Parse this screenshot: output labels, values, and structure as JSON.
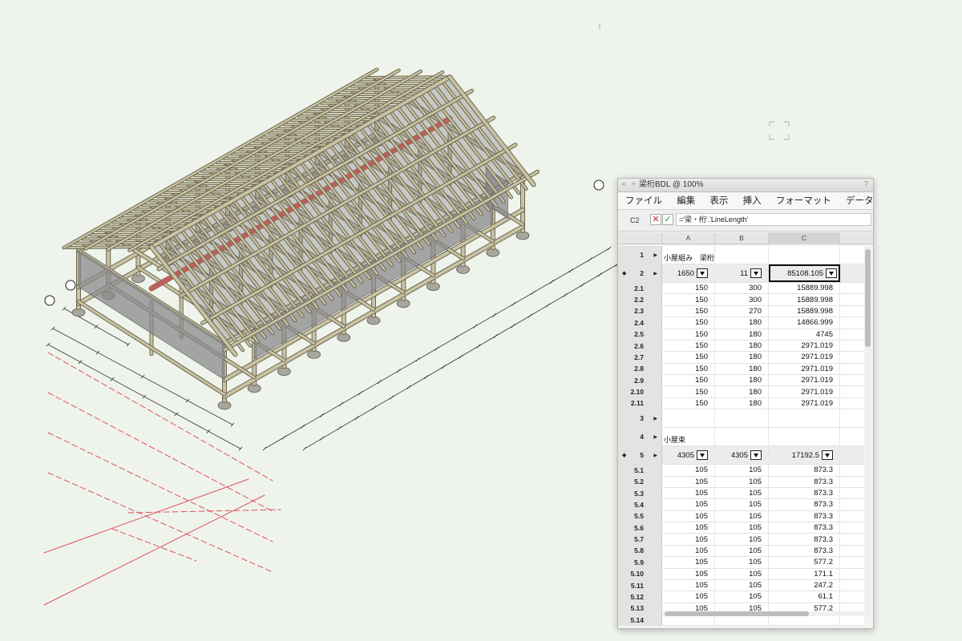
{
  "window": {
    "title": "梁桁BDL @ 100%",
    "controls": "× +",
    "help": "?"
  },
  "menu": [
    "ファイル",
    "編集",
    "表示",
    "挿入",
    "フォーマット",
    "データベース"
  ],
  "formula": {
    "cell_ref": "C2",
    "cancel": "✕",
    "accept": "✓",
    "value": "='梁・桁'.'LineLength'"
  },
  "columns": [
    "A",
    "B",
    "C"
  ],
  "rows": [
    {
      "id": "1",
      "type": "header",
      "label": "小屋組み　梁桁"
    },
    {
      "id": "2",
      "type": "summary",
      "a": "1650",
      "b": "11",
      "c": "85108.105",
      "active": true
    },
    {
      "id": "2.1",
      "a": "150",
      "b": "300",
      "c": "15889.998"
    },
    {
      "id": "2.2",
      "a": "150",
      "b": "300",
      "c": "15889.998"
    },
    {
      "id": "2.3",
      "a": "150",
      "b": "270",
      "c": "15889.998"
    },
    {
      "id": "2.4",
      "a": "150",
      "b": "180",
      "c": "14866.999"
    },
    {
      "id": "2.5",
      "a": "150",
      "b": "180",
      "c": "4745"
    },
    {
      "id": "2.6",
      "a": "150",
      "b": "180",
      "c": "2971.019"
    },
    {
      "id": "2.7",
      "a": "150",
      "b": "180",
      "c": "2971.019"
    },
    {
      "id": "2.8",
      "a": "150",
      "b": "180",
      "c": "2971.019"
    },
    {
      "id": "2.9",
      "a": "150",
      "b": "180",
      "c": "2971.019"
    },
    {
      "id": "2.10",
      "a": "150",
      "b": "180",
      "c": "2971.019"
    },
    {
      "id": "2.11",
      "a": "150",
      "b": "180",
      "c": "2971.019"
    },
    {
      "id": "3",
      "type": "header",
      "label": ""
    },
    {
      "id": "4",
      "type": "header",
      "label": "小屋束"
    },
    {
      "id": "5",
      "type": "summary",
      "a": "4305",
      "b": "4305",
      "c": "17192.5"
    },
    {
      "id": "5.1",
      "a": "105",
      "b": "105",
      "c": "873.3"
    },
    {
      "id": "5.2",
      "a": "105",
      "b": "105",
      "c": "873.3"
    },
    {
      "id": "5.3",
      "a": "105",
      "b": "105",
      "c": "873.3"
    },
    {
      "id": "5.4",
      "a": "105",
      "b": "105",
      "c": "873.3"
    },
    {
      "id": "5.5",
      "a": "105",
      "b": "105",
      "c": "873.3"
    },
    {
      "id": "5.6",
      "a": "105",
      "b": "105",
      "c": "873.3"
    },
    {
      "id": "5.7",
      "a": "105",
      "b": "105",
      "c": "873.3"
    },
    {
      "id": "5.8",
      "a": "105",
      "b": "105",
      "c": "873.3"
    },
    {
      "id": "5.9",
      "a": "105",
      "b": "105",
      "c": "577.2"
    },
    {
      "id": "5.10",
      "a": "105",
      "b": "105",
      "c": "171.1"
    },
    {
      "id": "5.11",
      "a": "105",
      "b": "105",
      "c": "247.2"
    },
    {
      "id": "5.12",
      "a": "105",
      "b": "105",
      "c": "61.1"
    },
    {
      "id": "5.13",
      "a": "105",
      "b": "105",
      "c": "577.2"
    },
    {
      "id": "5.14",
      "a": "",
      "b": "",
      "c": ""
    }
  ],
  "colors": {
    "background": "#eef4ec",
    "timber": "#c9c3a4",
    "timber_dark": "#6b6650",
    "panel": "#8a8a8c",
    "ridge_beam": "#b8625c",
    "grid_red": "#e0525a",
    "dimension": "#333333"
  }
}
